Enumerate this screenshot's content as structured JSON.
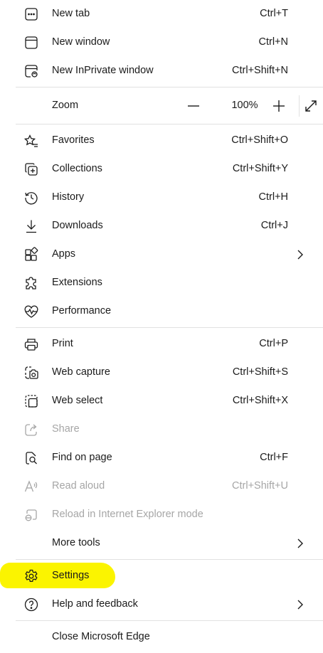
{
  "menu": {
    "new_tab": {
      "label": "New tab",
      "shortcut": "Ctrl+T",
      "icon": "new-tab-icon"
    },
    "new_window": {
      "label": "New window",
      "shortcut": "Ctrl+N",
      "icon": "new-window-icon"
    },
    "new_inprivate": {
      "label": "New InPrivate window",
      "shortcut": "Ctrl+Shift+N",
      "icon": "inprivate-icon"
    },
    "zoom": {
      "label": "Zoom",
      "value": "100%",
      "icons": [
        "minus-icon",
        "plus-icon",
        "fullscreen-icon"
      ]
    },
    "favorites": {
      "label": "Favorites",
      "shortcut": "Ctrl+Shift+O",
      "icon": "star-icon"
    },
    "collections": {
      "label": "Collections",
      "shortcut": "Ctrl+Shift+Y",
      "icon": "collections-icon"
    },
    "history": {
      "label": "History",
      "shortcut": "Ctrl+H",
      "icon": "history-icon"
    },
    "downloads": {
      "label": "Downloads",
      "shortcut": "Ctrl+J",
      "icon": "download-icon"
    },
    "apps": {
      "label": "Apps",
      "icon": "apps-icon",
      "submenu": true
    },
    "extensions": {
      "label": "Extensions",
      "icon": "puzzle-icon"
    },
    "performance": {
      "label": "Performance",
      "icon": "heartbeat-icon"
    },
    "print": {
      "label": "Print",
      "shortcut": "Ctrl+P",
      "icon": "printer-icon"
    },
    "web_capture": {
      "label": "Web capture",
      "shortcut": "Ctrl+Shift+S",
      "icon": "camera-icon"
    },
    "web_select": {
      "label": "Web select",
      "shortcut": "Ctrl+Shift+X",
      "icon": "select-icon"
    },
    "share": {
      "label": "Share",
      "icon": "share-icon",
      "disabled": true
    },
    "find_on_page": {
      "label": "Find on page",
      "shortcut": "Ctrl+F",
      "icon": "find-icon"
    },
    "read_aloud": {
      "label": "Read aloud",
      "shortcut": "Ctrl+Shift+U",
      "icon": "read-aloud-icon",
      "disabled": true
    },
    "reload_ie": {
      "label": "Reload in Internet Explorer mode",
      "icon": "ie-mode-icon",
      "disabled": true
    },
    "more_tools": {
      "label": "More tools",
      "submenu": true
    },
    "settings": {
      "label": "Settings",
      "icon": "gear-icon",
      "highlighted": true
    },
    "help": {
      "label": "Help and feedback",
      "icon": "help-icon",
      "submenu": true
    },
    "close": {
      "label": "Close Microsoft Edge"
    }
  },
  "colors": {
    "text": "#1b1b1b",
    "disabled_text": "#a6a6a6",
    "separator": "#e1e1e1",
    "highlight": "#fbf400",
    "background": "#ffffff"
  }
}
